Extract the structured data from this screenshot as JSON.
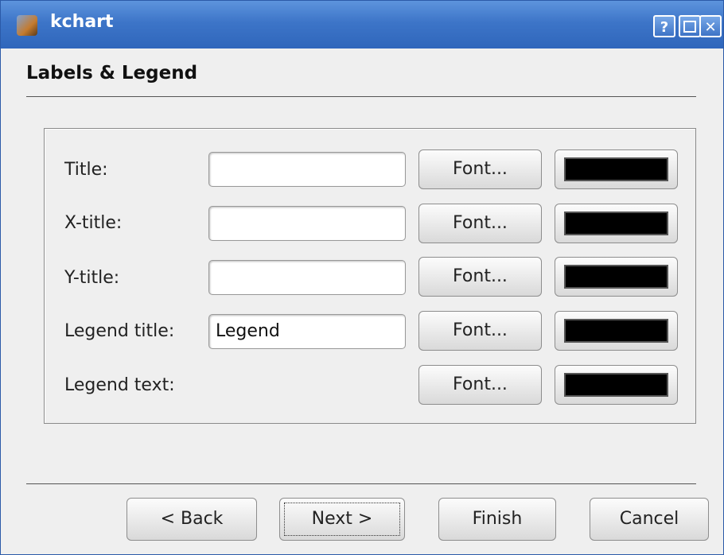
{
  "window": {
    "title": "kchart",
    "help_label": "?",
    "close_label": "✕"
  },
  "page": {
    "heading": "Labels & Legend"
  },
  "rows": [
    {
      "label": "Title:",
      "value": "",
      "font_label": "Font...",
      "color": "#000000"
    },
    {
      "label": "X-title:",
      "value": "",
      "font_label": "Font...",
      "color": "#000000"
    },
    {
      "label": "Y-title:",
      "value": "",
      "font_label": "Font...",
      "color": "#000000"
    },
    {
      "label": "Legend title:",
      "value": "Legend",
      "font_label": "Font...",
      "color": "#000000"
    },
    {
      "label": "Legend text:",
      "font_label": "Font...",
      "color": "#000000"
    }
  ],
  "buttons": {
    "back": "< Back",
    "next": "Next >",
    "finish": "Finish",
    "cancel": "Cancel"
  }
}
